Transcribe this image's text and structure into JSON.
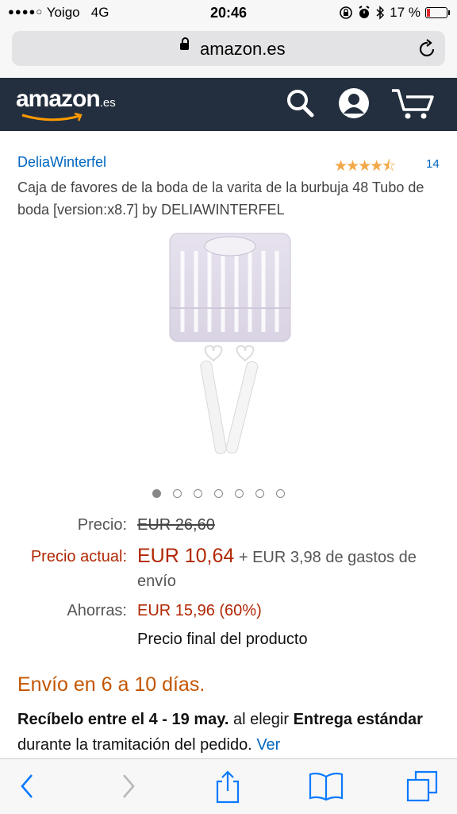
{
  "status_bar": {
    "carrier": "Yoigo",
    "network": "4G",
    "time": "20:46",
    "battery": "17 %",
    "battery_level": 0.17
  },
  "browser": {
    "url": "amazon.es"
  },
  "header": {
    "logo": "amazon",
    "logo_suffix": ".es"
  },
  "product": {
    "brand": "DeliaWinterfel",
    "rating_stars": 4.5,
    "review_count": "14",
    "title": "Caja de favores de la boda de la varita de la burbuja 48 Tubo de boda [version:x8.7] by DELIAWINTERFEL",
    "carousel_total": 7,
    "carousel_active": 0
  },
  "pricing": {
    "list_label": "Precio:",
    "list_price": "EUR 26,60",
    "current_label": "Precio actual:",
    "current_price": "EUR 10,64",
    "shipping": "+ EUR 3,98 de gastos de envío",
    "savings_label": "Ahorras:",
    "savings_value": "EUR 15,96 (60%)",
    "final_note": "Precio final del producto"
  },
  "delivery": {
    "headline": "Envío en 6 a 10 días.",
    "part1": "Recíbelo entre el 4 - 19 may.",
    "part2": " al elegir ",
    "part3": "Entrega estándar",
    "part4": " durante la tramitación del pedido. ",
    "link": "Ver"
  },
  "colors": {
    "header_bg": "#232f3e",
    "link": "#0066c0",
    "price_red": "#b12704",
    "delivery_orange": "#c45500",
    "star": "#f3a847",
    "ios_blue": "#0a7aff"
  }
}
